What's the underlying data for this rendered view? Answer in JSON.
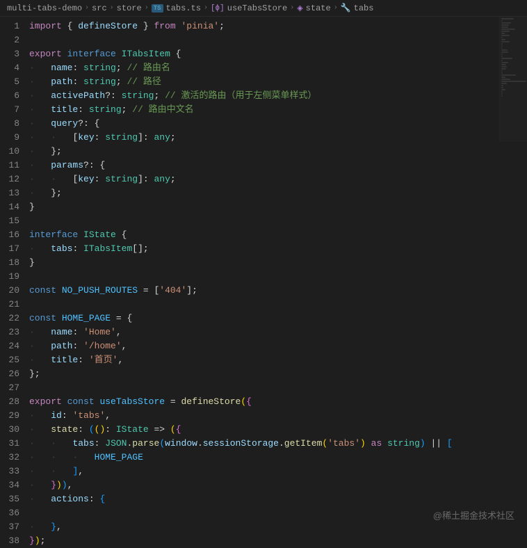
{
  "breadcrumb": {
    "items": [
      {
        "label": "multi-tabs-demo",
        "kind": "folder"
      },
      {
        "label": "src",
        "kind": "folder"
      },
      {
        "label": "store",
        "kind": "folder"
      },
      {
        "label": "tabs.ts",
        "kind": "file",
        "badge": "TS"
      },
      {
        "label": "useTabsStore",
        "kind": "symbol",
        "icon": "[ϕ]"
      },
      {
        "label": "state",
        "kind": "symbol",
        "icon": "◈"
      },
      {
        "label": "tabs",
        "kind": "symbol",
        "icon": "🔧"
      }
    ]
  },
  "line_start": 1,
  "line_end": 38,
  "code_lines": [
    [
      [
        "keyword",
        "import"
      ],
      [
        "punc",
        " { "
      ],
      [
        "prop",
        "defineStore"
      ],
      [
        "punc",
        " } "
      ],
      [
        "keyword",
        "from"
      ],
      [
        "punc",
        " "
      ],
      [
        "string",
        "'pinia'"
      ],
      [
        "punc",
        ";"
      ]
    ],
    [],
    [
      [
        "keyword",
        "export"
      ],
      [
        "punc",
        " "
      ],
      [
        "type",
        "interface"
      ],
      [
        "punc",
        " "
      ],
      [
        "interface",
        "ITabsItem"
      ],
      [
        "punc",
        " {"
      ]
    ],
    [
      [
        "guide",
        "·"
      ],
      [
        "prop",
        "name"
      ],
      [
        "punc",
        ": "
      ],
      [
        "interface",
        "string"
      ],
      [
        "punc",
        "; "
      ],
      [
        "comment",
        "// 路由名"
      ]
    ],
    [
      [
        "guide",
        "·"
      ],
      [
        "prop",
        "path"
      ],
      [
        "punc",
        ": "
      ],
      [
        "interface",
        "string"
      ],
      [
        "punc",
        "; "
      ],
      [
        "comment",
        "// 路径"
      ]
    ],
    [
      [
        "guide",
        "·"
      ],
      [
        "prop",
        "activePath"
      ],
      [
        "punc",
        "?: "
      ],
      [
        "interface",
        "string"
      ],
      [
        "punc",
        "; "
      ],
      [
        "comment",
        "// 激活的路由（用于左侧菜单样式）"
      ]
    ],
    [
      [
        "guide",
        "·"
      ],
      [
        "prop",
        "title"
      ],
      [
        "punc",
        ": "
      ],
      [
        "interface",
        "string"
      ],
      [
        "punc",
        "; "
      ],
      [
        "comment",
        "// 路由中文名"
      ]
    ],
    [
      [
        "guide",
        "·"
      ],
      [
        "prop",
        "query"
      ],
      [
        "punc",
        "?: {"
      ]
    ],
    [
      [
        "guide",
        "· · "
      ],
      [
        "punc",
        "["
      ],
      [
        "prop",
        "key"
      ],
      [
        "punc",
        ": "
      ],
      [
        "interface",
        "string"
      ],
      [
        "punc",
        "]: "
      ],
      [
        "interface",
        "any"
      ],
      [
        "punc",
        ";"
      ]
    ],
    [
      [
        "guide",
        "·"
      ],
      [
        "punc",
        "};"
      ]
    ],
    [
      [
        "guide",
        "·"
      ],
      [
        "prop",
        "params"
      ],
      [
        "punc",
        "?: {"
      ]
    ],
    [
      [
        "guide",
        "· · "
      ],
      [
        "punc",
        "["
      ],
      [
        "prop",
        "key"
      ],
      [
        "punc",
        ": "
      ],
      [
        "interface",
        "string"
      ],
      [
        "punc",
        "]: "
      ],
      [
        "interface",
        "any"
      ],
      [
        "punc",
        ";"
      ]
    ],
    [
      [
        "guide",
        "·"
      ],
      [
        "punc",
        "};"
      ]
    ],
    [
      [
        "punc",
        "}"
      ]
    ],
    [],
    [
      [
        "type",
        "interface"
      ],
      [
        "punc",
        " "
      ],
      [
        "interface",
        "IState"
      ],
      [
        "punc",
        " {"
      ]
    ],
    [
      [
        "guide",
        "·"
      ],
      [
        "prop",
        "tabs"
      ],
      [
        "punc",
        ": "
      ],
      [
        "interface",
        "ITabsItem"
      ],
      [
        "punc",
        "[];"
      ]
    ],
    [
      [
        "punc",
        "}"
      ]
    ],
    [],
    [
      [
        "type",
        "const"
      ],
      [
        "punc",
        " "
      ],
      [
        "const",
        "NO_PUSH_ROUTES"
      ],
      [
        "punc",
        " = ["
      ],
      [
        "string",
        "'404'"
      ],
      [
        "punc",
        "];"
      ]
    ],
    [],
    [
      [
        "type",
        "const"
      ],
      [
        "punc",
        " "
      ],
      [
        "const",
        "HOME_PAGE"
      ],
      [
        "punc",
        " = {"
      ]
    ],
    [
      [
        "guide",
        "·"
      ],
      [
        "prop",
        "name"
      ],
      [
        "punc",
        ": "
      ],
      [
        "string",
        "'Home'"
      ],
      [
        "punc",
        ","
      ]
    ],
    [
      [
        "guide",
        "·"
      ],
      [
        "prop",
        "path"
      ],
      [
        "punc",
        ": "
      ],
      [
        "string",
        "'/home'"
      ],
      [
        "punc",
        ","
      ]
    ],
    [
      [
        "guide",
        "·"
      ],
      [
        "prop",
        "title"
      ],
      [
        "punc",
        ": "
      ],
      [
        "string",
        "'首页'"
      ],
      [
        "punc",
        ","
      ]
    ],
    [
      [
        "punc",
        "};"
      ]
    ],
    [],
    [
      [
        "keyword",
        "export"
      ],
      [
        "punc",
        " "
      ],
      [
        "type",
        "const"
      ],
      [
        "punc",
        " "
      ],
      [
        "const",
        "useTabsStore"
      ],
      [
        "punc",
        " = "
      ],
      [
        "func",
        "defineStore"
      ],
      [
        "brace",
        "("
      ],
      [
        "brace2",
        "{"
      ]
    ],
    [
      [
        "guide",
        "·"
      ],
      [
        "prop",
        "id"
      ],
      [
        "punc",
        ": "
      ],
      [
        "string",
        "'tabs'"
      ],
      [
        "punc",
        ","
      ]
    ],
    [
      [
        "guide",
        "·"
      ],
      [
        "func",
        "state"
      ],
      [
        "punc",
        ": "
      ],
      [
        "brace3",
        "("
      ],
      [
        "brace",
        "()"
      ],
      [
        "punc",
        ": "
      ],
      [
        "interface",
        "IState"
      ],
      [
        "punc",
        " => "
      ],
      [
        "brace",
        "("
      ],
      [
        "brace2",
        "{"
      ]
    ],
    [
      [
        "guide",
        "· · "
      ],
      [
        "prop",
        "tabs"
      ],
      [
        "punc",
        ": "
      ],
      [
        "interface",
        "JSON"
      ],
      [
        "punc",
        "."
      ],
      [
        "func",
        "parse"
      ],
      [
        "brace3",
        "("
      ],
      [
        "prop",
        "window"
      ],
      [
        "punc",
        "."
      ],
      [
        "prop",
        "sessionStorage"
      ],
      [
        "punc",
        "."
      ],
      [
        "func",
        "getItem"
      ],
      [
        "brace",
        "("
      ],
      [
        "string",
        "'tabs'"
      ],
      [
        "brace",
        ")"
      ],
      [
        "punc",
        " "
      ],
      [
        "keyword",
        "as"
      ],
      [
        "punc",
        " "
      ],
      [
        "interface",
        "string"
      ],
      [
        "brace3",
        ")"
      ],
      [
        "punc",
        " || "
      ],
      [
        "brace3",
        "["
      ]
    ],
    [
      [
        "guide",
        "· · · "
      ],
      [
        "const",
        "HOME_PAGE"
      ]
    ],
    [
      [
        "guide",
        "· · "
      ],
      [
        "brace3",
        "]"
      ],
      [
        "punc",
        ","
      ]
    ],
    [
      [
        "guide",
        "·"
      ],
      [
        "brace2",
        "}"
      ],
      [
        "brace",
        ")"
      ],
      [
        "brace3",
        ")"
      ],
      [
        "punc",
        ","
      ]
    ],
    [
      [
        "guide",
        "·"
      ],
      [
        "prop",
        "actions"
      ],
      [
        "punc",
        ": "
      ],
      [
        "brace3",
        "{"
      ]
    ],
    [],
    [
      [
        "guide",
        "·"
      ],
      [
        "brace3",
        "}"
      ],
      [
        "punc",
        ","
      ]
    ],
    [
      [
        "brace2",
        "}"
      ],
      [
        "brace",
        ")"
      ],
      [
        "punc",
        ";"
      ]
    ]
  ],
  "watermark": "@稀土掘金技术社区"
}
